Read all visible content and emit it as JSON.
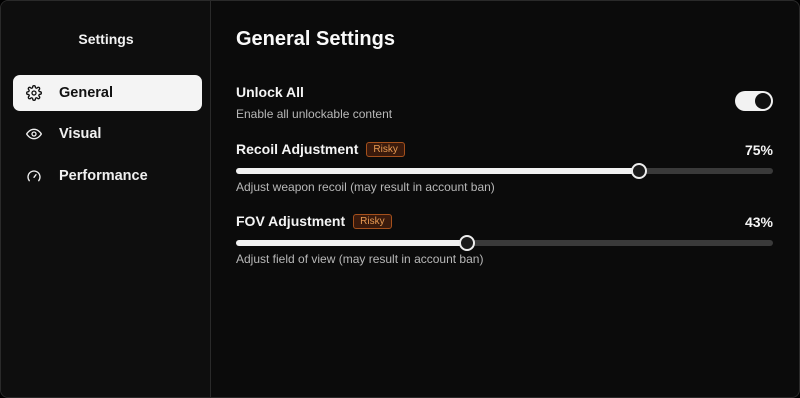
{
  "sidebar": {
    "title": "Settings",
    "items": [
      {
        "label": "General",
        "icon": "gear-icon",
        "active": true
      },
      {
        "label": "Visual",
        "icon": "eye-icon",
        "active": false
      },
      {
        "label": "Performance",
        "icon": "gauge-icon",
        "active": false
      }
    ]
  },
  "main": {
    "title": "General Settings",
    "unlock_all": {
      "label": "Unlock All",
      "description": "Enable all unlockable content",
      "enabled": true
    },
    "recoil": {
      "label": "Recoil Adjustment",
      "badge": "Risky",
      "value_text": "75%",
      "value": 0.75,
      "description": "Adjust weapon recoil (may result in account ban)"
    },
    "fov": {
      "label": "FOV Adjustment",
      "badge": "Risky",
      "value_text": "43%",
      "value": 0.43,
      "description": "Adjust field of view (may result in account ban)"
    }
  },
  "colors": {
    "background": "#0b0b0b",
    "accent": "#f2f2f2",
    "risky_badge_text": "#e79a52",
    "risky_badge_border": "#a4501c"
  }
}
